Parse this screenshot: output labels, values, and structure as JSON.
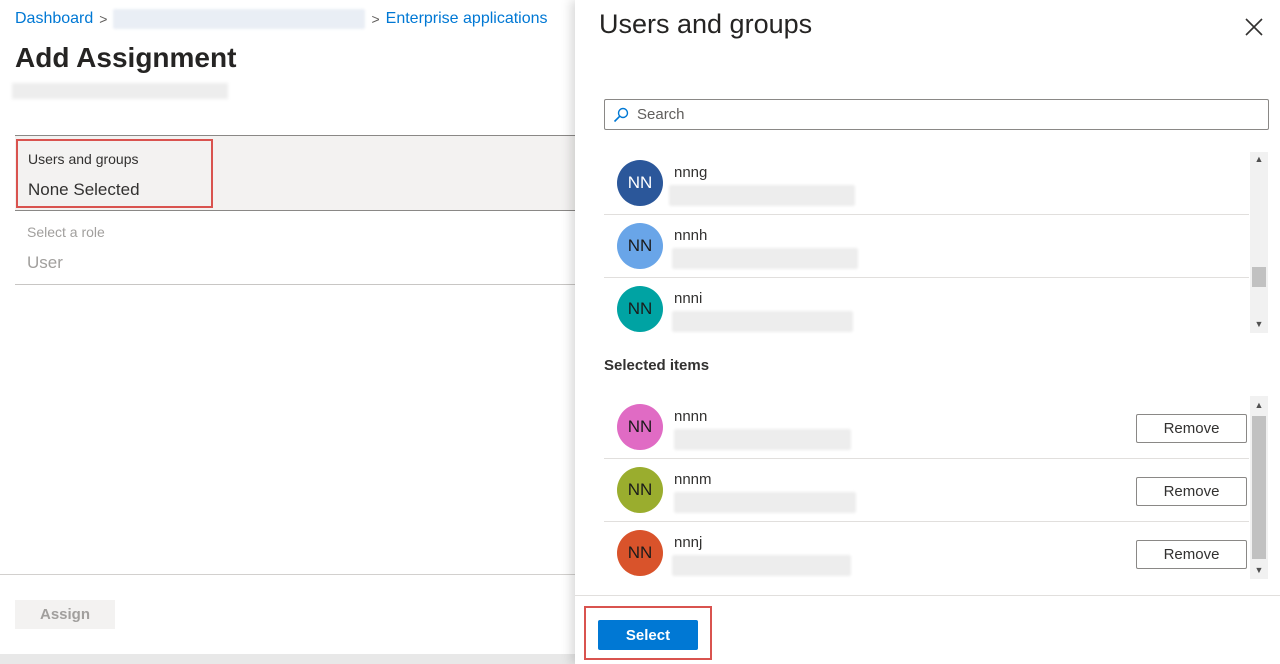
{
  "breadcrumb": {
    "dashboard": "Dashboard",
    "enterprise": "Enterprise applications"
  },
  "page": {
    "title": "Add Assignment",
    "users_label": "Users and groups",
    "users_value": "None Selected",
    "role_label": "Select a role",
    "role_value": "User",
    "assign_label": "Assign"
  },
  "panel": {
    "title": "Users and groups",
    "search_placeholder": "Search",
    "results": [
      {
        "initials": "NN",
        "name": "nnng",
        "color": "#2b579a",
        "text_color": "#ffffff"
      },
      {
        "initials": "NN",
        "name": "nnnh",
        "color": "#69a5e8",
        "text_color": "#1b1b1b"
      },
      {
        "initials": "NN",
        "name": "nnni",
        "color": "#00a3a3",
        "text_color": "#1b1b1b"
      }
    ],
    "selected_heading": "Selected items",
    "selected": [
      {
        "initials": "NN",
        "name": "nnnn",
        "color": "#e06bc4",
        "text_color": "#1b1b1b",
        "remove_label": "Remove"
      },
      {
        "initials": "NN",
        "name": "nnnm",
        "color": "#9aad2e",
        "text_color": "#1b1b1b",
        "remove_label": "Remove"
      },
      {
        "initials": "NN",
        "name": "nnnj",
        "color": "#d9532b",
        "text_color": "#1b1b1b",
        "remove_label": "Remove"
      }
    ],
    "select_label": "Select"
  },
  "icons": {
    "close": "close-icon",
    "search": "search-icon",
    "chevron": "chevron-right-icon",
    "scroll_up": "scroll-up-icon",
    "scroll_down": "scroll-down-icon"
  },
  "colors": {
    "accent": "#0078d4",
    "highlight": "#d9534f"
  }
}
